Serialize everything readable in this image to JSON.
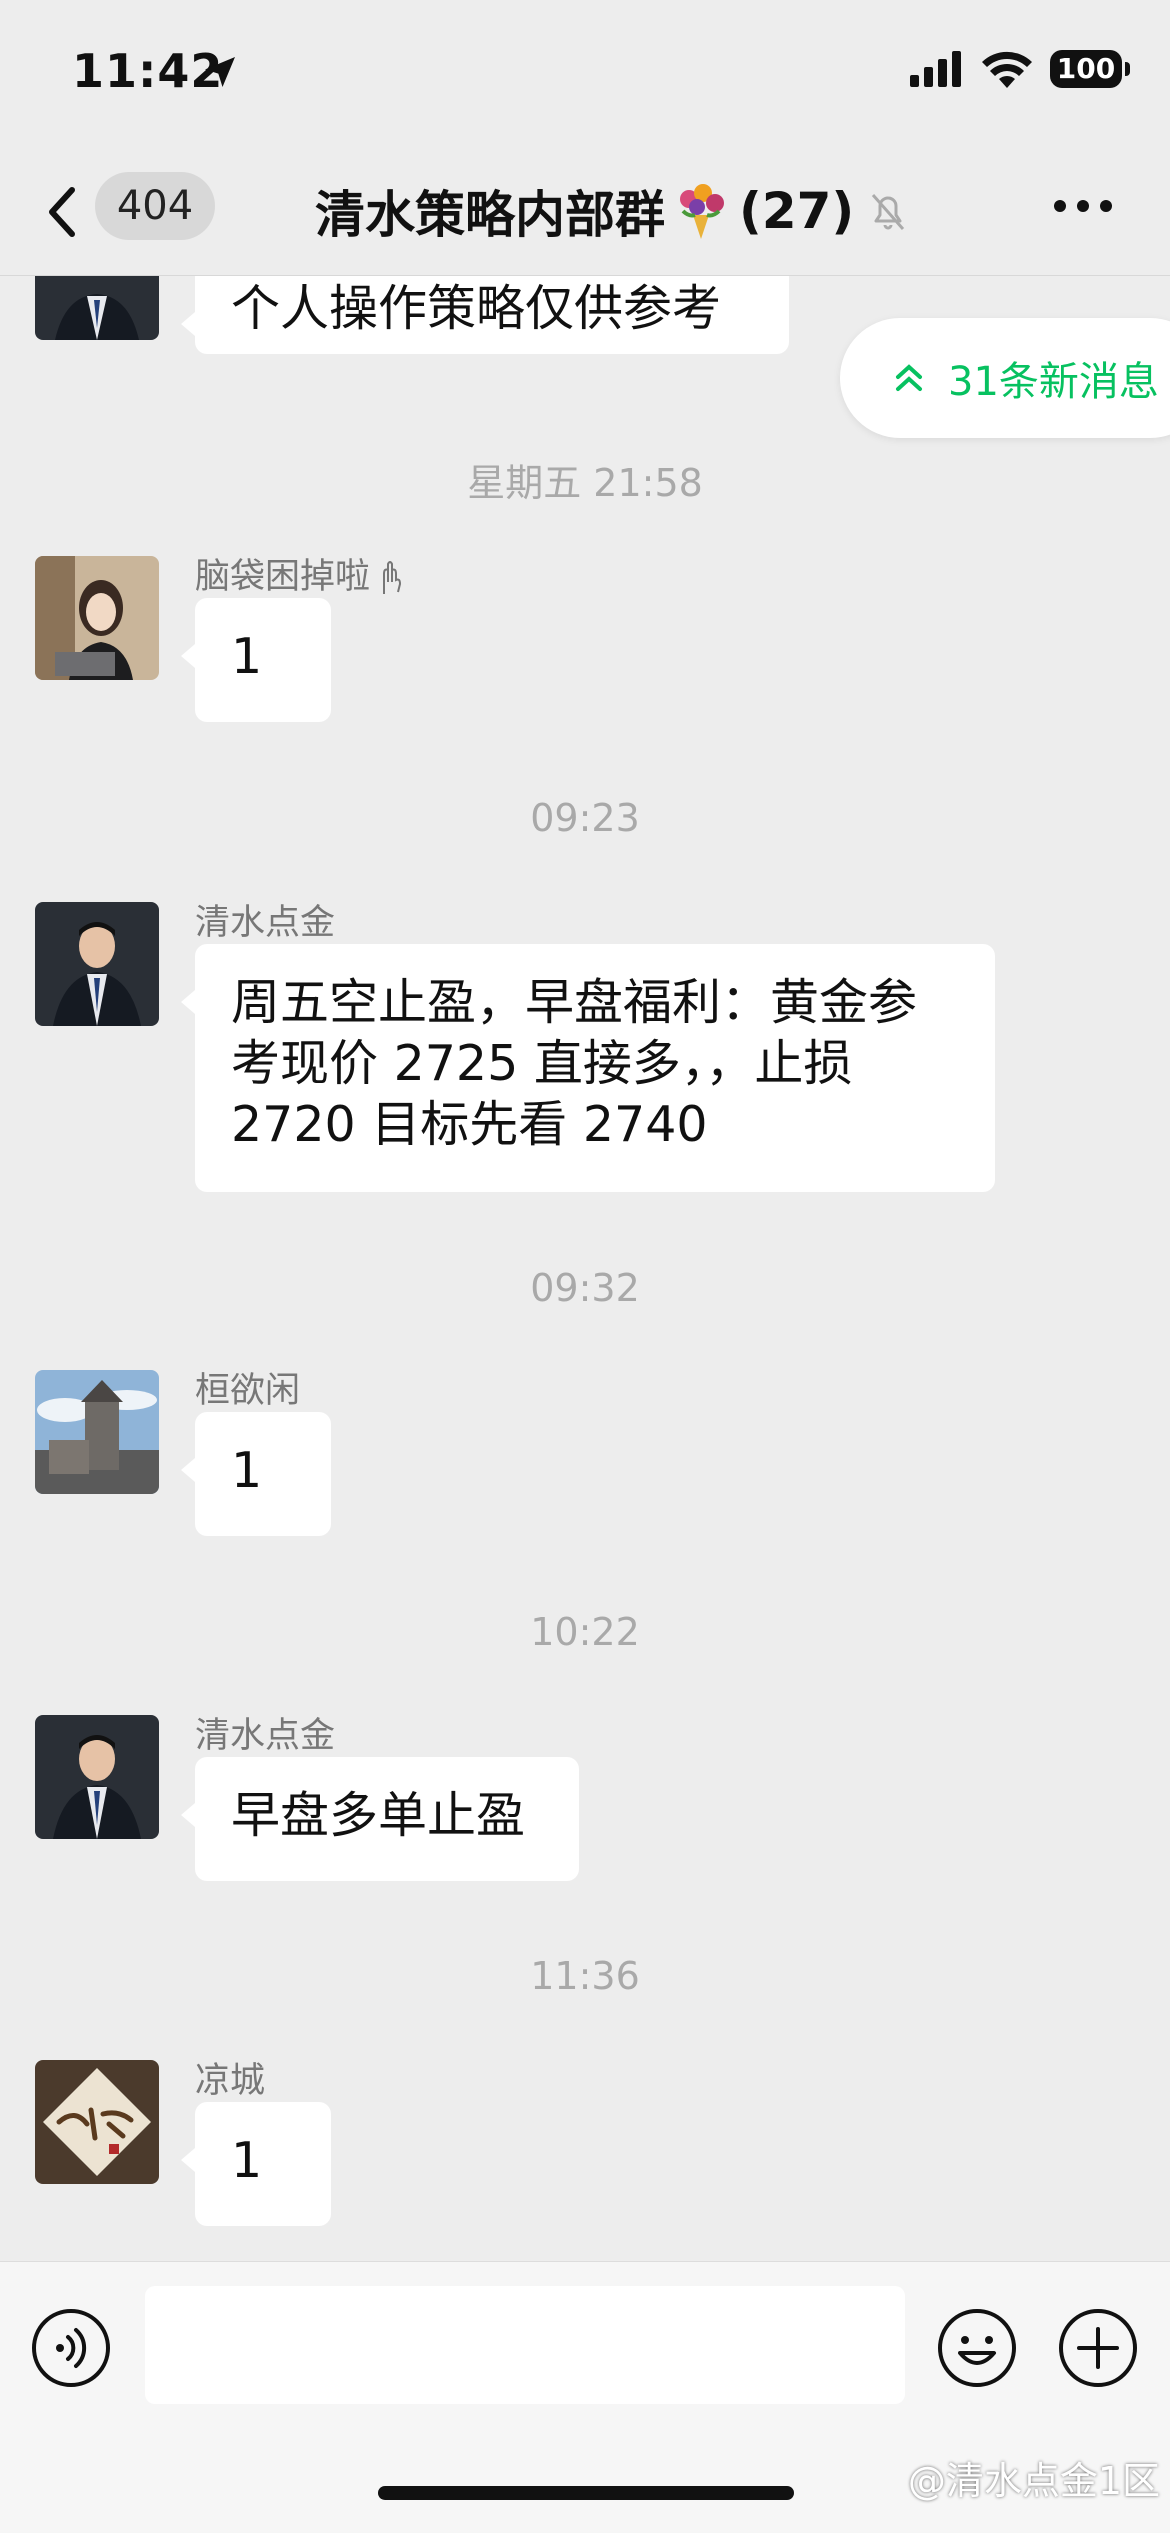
{
  "status_bar": {
    "time": "11:42",
    "battery": "100"
  },
  "nav": {
    "unread_count": "404",
    "title": "清水策略内部群",
    "member_count": "(27)"
  },
  "new_messages": {
    "label": "31条新消息"
  },
  "messages": [
    {
      "type": "text",
      "text": "个人操作策略仅供参考"
    },
    {
      "type": "time",
      "text": "星期五 21:58"
    },
    {
      "type": "text",
      "sender": "脑袋困掉啦",
      "text": "1"
    },
    {
      "type": "time",
      "text": "09:23"
    },
    {
      "type": "text",
      "sender": "清水点金",
      "text": "周五空止盈，早盘福利：黄金参考现价 2725 直接多，，止损 2720 目标先看 2740"
    },
    {
      "type": "time",
      "text": "09:32"
    },
    {
      "type": "text",
      "sender": "桓欲闲",
      "text": "1"
    },
    {
      "type": "time",
      "text": "10:22"
    },
    {
      "type": "text",
      "sender": "清水点金",
      "text": "早盘多单止盈"
    },
    {
      "type": "time",
      "text": "11:36"
    },
    {
      "type": "text",
      "sender": "凉城",
      "text": "1"
    }
  ],
  "input": {
    "value": ""
  },
  "watermark": "@清水点金1区"
}
